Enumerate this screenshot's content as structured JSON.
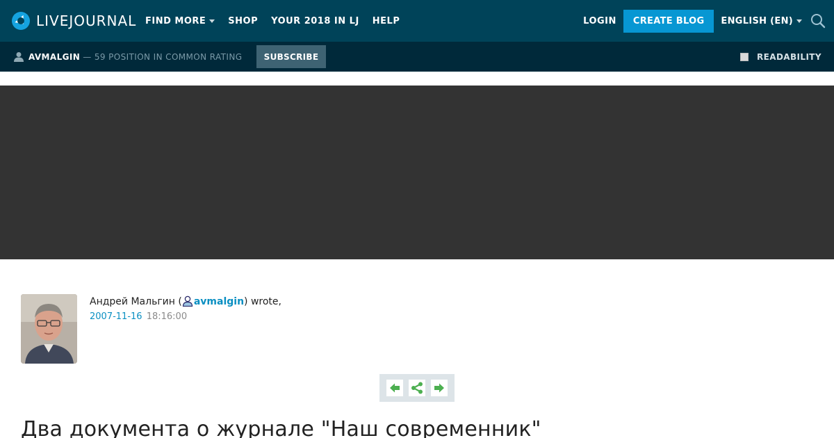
{
  "header": {
    "logo_text": "LIVEJOURNAL",
    "nav": [
      {
        "label": "FIND MORE",
        "has_caret": true
      },
      {
        "label": "SHOP",
        "has_caret": false
      },
      {
        "label": "YOUR 2018 IN LJ",
        "has_caret": false
      },
      {
        "label": "HELP",
        "has_caret": false
      }
    ],
    "login_label": "LOGIN",
    "create_blog_label": "CREATE BLOG",
    "language_label": "ENGLISH (EN)",
    "search_icon": "search-icon"
  },
  "subheader": {
    "username": "AVMALGIN",
    "rating_text": "— 59 POSITION IN COMMON RATING",
    "subscribe_label": "SUBSCRIBE",
    "readability_label": "READABILITY"
  },
  "post": {
    "author_name": "Андрей Мальгин (",
    "author_username": "avmalgin",
    "wrote_text": ") wrote,",
    "date": "2007-11-16",
    "time": "18:16:00",
    "title": "Два документа о журнале \"Наш современник\""
  },
  "colors": {
    "header_bg": "#004359",
    "subheader_bg": "#00293a",
    "accent": "#0797d3",
    "link": "#0a8fc2",
    "banner_bg": "#333333",
    "nav_arrows": "#4caf50"
  }
}
